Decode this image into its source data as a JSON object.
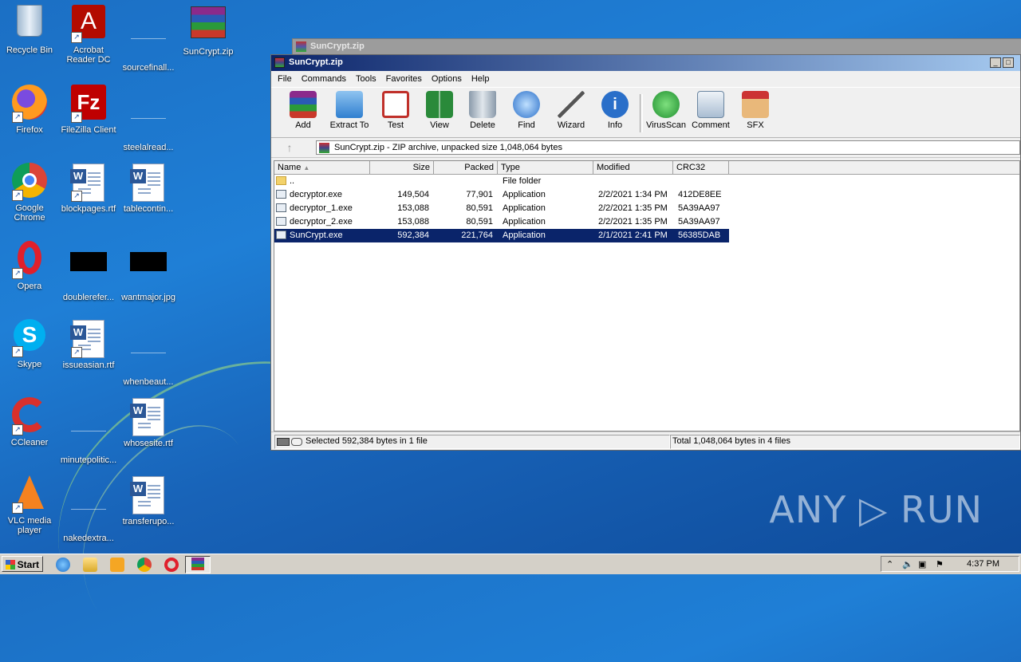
{
  "desktop": {
    "icons": [
      {
        "label": "Recycle Bin",
        "icon": "recycle-bin-icon"
      },
      {
        "label": "Acrobat Reader DC",
        "icon": "acrobat-icon"
      },
      {
        "label": "sourcefinall...",
        "icon": "blank-file-icon"
      },
      {
        "label": "SunCrypt.zip",
        "icon": "winrar-archive-icon"
      },
      {
        "label": "Firefox",
        "icon": "firefox-icon"
      },
      {
        "label": "FileZilla Client",
        "icon": "filezilla-icon"
      },
      {
        "label": "steelalread...",
        "icon": "blank-file-icon"
      },
      {
        "label": "Google Chrome",
        "icon": "chrome-icon"
      },
      {
        "label": "blockpages.rtf",
        "icon": "word-doc-icon"
      },
      {
        "label": "tablecontin...",
        "icon": "word-doc-icon"
      },
      {
        "label": "Opera",
        "icon": "opera-icon"
      },
      {
        "label": "doublerefer...",
        "icon": "black-image-icon"
      },
      {
        "label": "wantmajor.jpg",
        "icon": "black-image-icon"
      },
      {
        "label": "Skype",
        "icon": "skype-icon"
      },
      {
        "label": "issueasian.rtf",
        "icon": "word-doc-icon"
      },
      {
        "label": "whenbeaut...",
        "icon": "blank-file-icon"
      },
      {
        "label": "CCleaner",
        "icon": "ccleaner-icon"
      },
      {
        "label": "minutepolitic...",
        "icon": "blank-file-icon"
      },
      {
        "label": "whosesite.rtf",
        "icon": "word-doc-icon"
      },
      {
        "label": "VLC media player",
        "icon": "vlc-icon"
      },
      {
        "label": "nakedextra...",
        "icon": "blank-file-icon"
      },
      {
        "label": "transferupo...",
        "icon": "word-doc-icon"
      }
    ]
  },
  "back_window": {
    "title": "SunCrypt.zip"
  },
  "window": {
    "title": "SunCrypt.zip",
    "menu": [
      "File",
      "Commands",
      "Tools",
      "Favorites",
      "Options",
      "Help"
    ],
    "toolbar": [
      "Add",
      "Extract To",
      "Test",
      "View",
      "Delete",
      "Find",
      "Wizard",
      "Info",
      "VirusScan",
      "Comment",
      "SFX"
    ],
    "address": "SunCrypt.zip - ZIP archive, unpacked size 1,048,064 bytes",
    "columns": [
      "Name",
      "Size",
      "Packed",
      "Type",
      "Modified",
      "CRC32"
    ],
    "rows": [
      {
        "name": "..",
        "size": "",
        "packed": "",
        "type": "File folder",
        "modified": "",
        "crc": "",
        "kind": "folder"
      },
      {
        "name": "decryptor.exe",
        "size": "149,504",
        "packed": "77,901",
        "type": "Application",
        "modified": "2/2/2021 1:34 PM",
        "crc": "412DE8EE",
        "kind": "exe"
      },
      {
        "name": "decryptor_1.exe",
        "size": "153,088",
        "packed": "80,591",
        "type": "Application",
        "modified": "2/2/2021 1:35 PM",
        "crc": "5A39AA97",
        "kind": "exe"
      },
      {
        "name": "decryptor_2.exe",
        "size": "153,088",
        "packed": "80,591",
        "type": "Application",
        "modified": "2/2/2021 1:35 PM",
        "crc": "5A39AA97",
        "kind": "exe"
      },
      {
        "name": "SunCrypt.exe",
        "size": "592,384",
        "packed": "221,764",
        "type": "Application",
        "modified": "2/1/2021 2:41 PM",
        "crc": "56385DAB",
        "kind": "exe",
        "selected": true
      }
    ],
    "status_left": "Selected 592,384 bytes in 1 file",
    "status_right": "Total 1,048,064 bytes in 4 files"
  },
  "taskbar": {
    "start": "Start",
    "clock": "4:37 PM"
  },
  "watermark": "ANY ▷ RUN"
}
